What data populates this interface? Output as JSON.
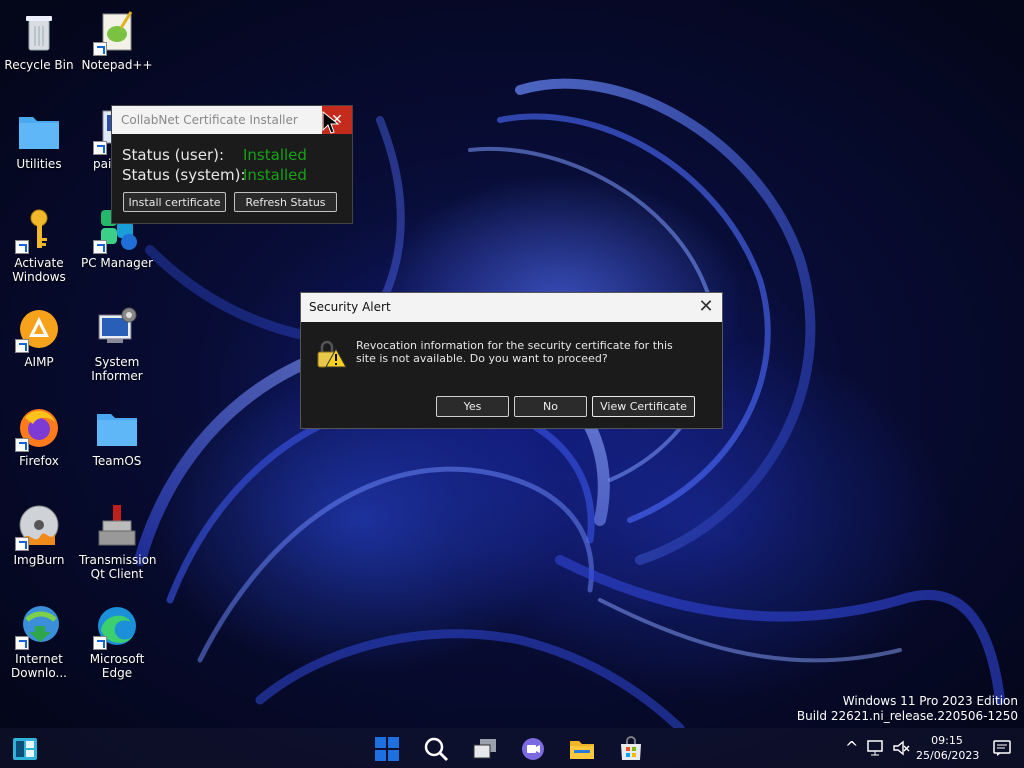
{
  "desktop": {
    "icons": [
      {
        "label": "Recycle Bin"
      },
      {
        "label": "Notepad++"
      },
      {
        "label": "Utilities"
      },
      {
        "label": "pai"
      },
      {
        "label": "Activate Windows"
      },
      {
        "label": "PC Manager"
      },
      {
        "label": "AIMP"
      },
      {
        "label": "System Informer"
      },
      {
        "label": "Firefox"
      },
      {
        "label": "TeamOS"
      },
      {
        "label": "ImgBurn"
      },
      {
        "label": "Transmission Qt Client"
      },
      {
        "label": "Internet Downlo..."
      },
      {
        "label": "Microsoft Edge"
      }
    ]
  },
  "collabnet": {
    "title": "CollabNet Certificate Installer",
    "status_user_label": "Status (user):",
    "status_user_value": "Installed",
    "status_system_label": "Status (system):",
    "status_system_value": "Installed",
    "install_button": "Install certificate",
    "refresh_button": "Refresh Status",
    "close_glyph": "✕"
  },
  "security_alert": {
    "title": "Security Alert",
    "message": "Revocation information for the security certificate for this site is not available. Do you want to proceed?",
    "yes_button": "Yes",
    "no_button": "No",
    "view_button": "View Certificate",
    "close_glyph": "✕",
    "icon": "warning-lock-icon"
  },
  "watermark": {
    "line1": "Windows 11 Pro 2023 Edition",
    "line2": "Build 22621.ni_release.220506-1250"
  },
  "taskbar": {
    "apps": [
      "widgets-icon",
      "start-icon",
      "search-icon",
      "task-view-icon",
      "chat-icon",
      "file-explorer-icon",
      "store-icon"
    ],
    "time": "09:15",
    "date": "25/06/2023",
    "chevron": "^"
  },
  "colors": {
    "installed_green": "#16a316",
    "close_red": "#c42b1c",
    "start_blue": "#1e6fe0"
  }
}
